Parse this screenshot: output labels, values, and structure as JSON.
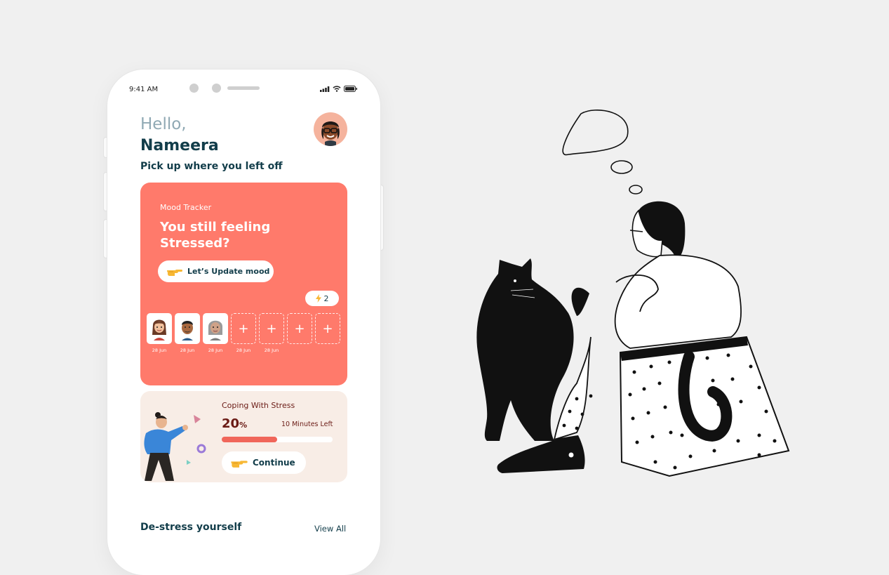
{
  "status_bar": {
    "time": "9:41 AM"
  },
  "greeting": {
    "hello": "Hello,",
    "name": "Nameera",
    "subtitle": "Pick up where you left off"
  },
  "mood_tracker": {
    "label": "Mood Tracker",
    "question": "You still feeling Stressed?",
    "button_label": "Let’s Update mood",
    "streak_count": "2",
    "days": [
      {
        "date": "28 Jun",
        "filled": true,
        "icon": "avatar-girl-icon"
      },
      {
        "date": "28 Jun",
        "filled": true,
        "icon": "avatar-man-icon"
      },
      {
        "date": "28 Jun",
        "filled": true,
        "icon": "avatar-grey-icon"
      },
      {
        "date": "28 Jun",
        "filled": false,
        "icon": "plus-icon"
      },
      {
        "date": "28 Jun",
        "filled": false,
        "icon": "plus-icon"
      },
      {
        "date": "",
        "filled": false,
        "icon": "plus-icon"
      },
      {
        "date": "",
        "filled": false,
        "icon": "plus-icon"
      }
    ],
    "plus_glyph": "+"
  },
  "coping": {
    "title": "Coping With Stress",
    "percent": "20",
    "percent_sign": "%",
    "progress": 0.5,
    "time_left": "10 Minutes Left",
    "button_label": "Continue"
  },
  "destress": {
    "title": "De-stress yourself",
    "view_all": "View All"
  },
  "colors": {
    "mood_card": "#ff7a6b",
    "coping_card": "#f8ede6",
    "primary_text": "#123d4a",
    "progress_fill": "#f0665a"
  }
}
